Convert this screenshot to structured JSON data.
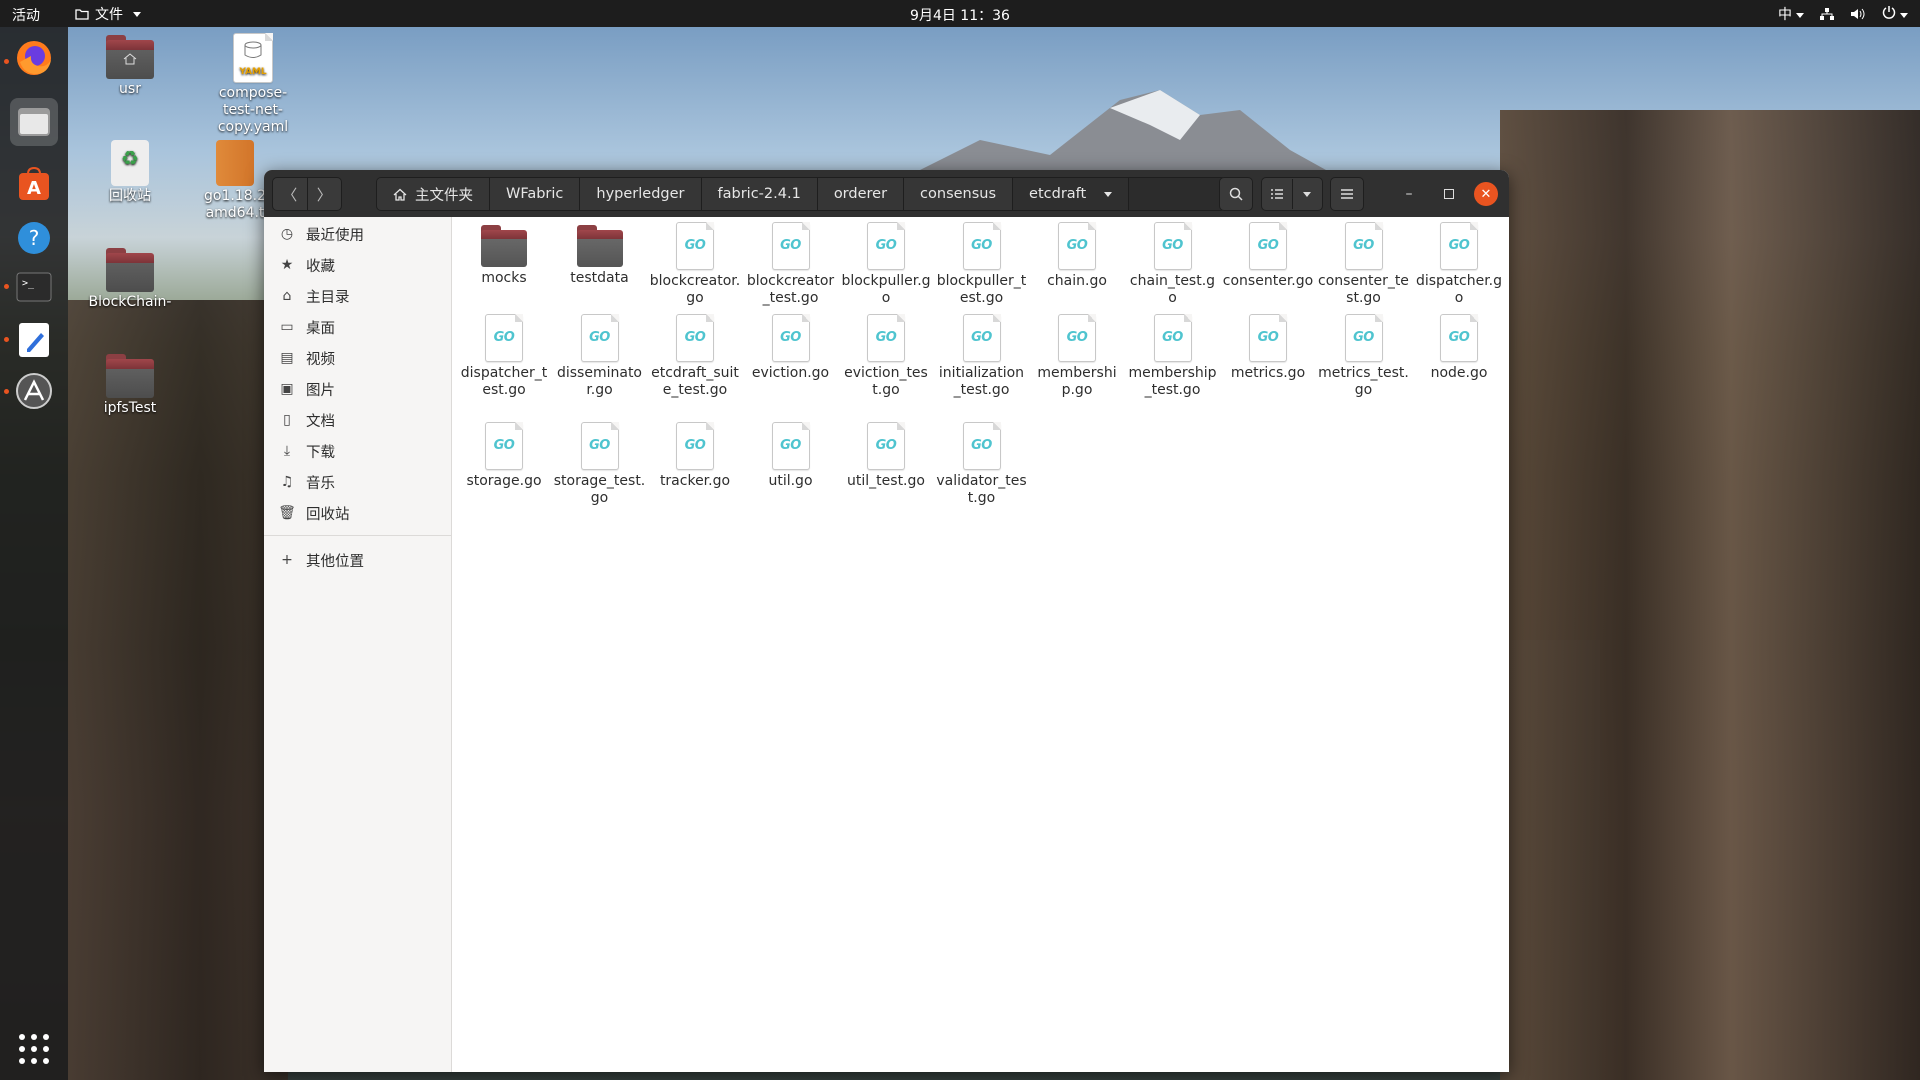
{
  "topbar": {
    "activities": "活动",
    "app_menu": "文件",
    "clock": "9月4日 11：36",
    "input_method": "中"
  },
  "desktop": {
    "icons": [
      {
        "label": "usr"
      },
      {
        "label": "compose-test-net-copy.yaml"
      },
      {
        "label": "回收站"
      },
      {
        "label": "go1.18.2 amd64.t"
      },
      {
        "label": "BlockChain-"
      },
      {
        "label": "ipfsTest"
      }
    ],
    "yaml_badge": "YAML"
  },
  "window": {
    "breadcrumbs": [
      "主文件夹",
      "WFabric",
      "hyperledger",
      "fabric-2.4.1",
      "orderer",
      "consensus",
      "etcdraft"
    ],
    "sidebar": {
      "items": [
        "最近使用",
        "收藏",
        "主目录",
        "桌面",
        "视频",
        "图片",
        "文档",
        "下载",
        "音乐",
        "回收站"
      ],
      "other": "其他位置"
    },
    "go_badge": "GO",
    "folders": [
      "mocks",
      "testdata"
    ],
    "files": [
      "blockcreator.go",
      "blockcreator_test.go",
      "blockpuller.go",
      "blockpuller_test.go",
      "chain.go",
      "chain_test.go",
      "consenter.go",
      "consenter_test.go",
      "dispatcher.go",
      "dispatcher_test.go",
      "disseminator.go",
      "etcdraft_suite_test.go",
      "eviction.go",
      "eviction_test.go",
      "initialization_test.go",
      "membership.go",
      "membership_test.go",
      "metrics.go",
      "metrics_test.go",
      "node.go",
      "storage.go",
      "storage_test.go",
      "tracker.go",
      "util.go",
      "util_test.go",
      "validator_test.go"
    ]
  },
  "colors": {
    "accent": "#e95420",
    "go_teal": "#4fc4cf",
    "folder_red": "#a0464b",
    "headerbar": "#303030"
  }
}
